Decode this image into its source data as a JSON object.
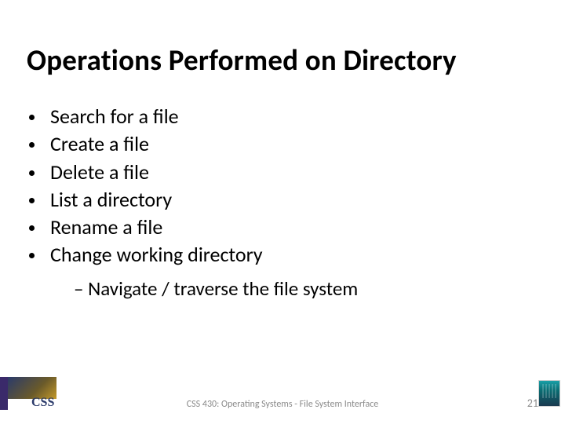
{
  "title": "Operations Performed on Directory",
  "bullets": [
    "Search for a file",
    "Create a file",
    "Delete a file",
    "List a directory",
    "Rename a file",
    "Change working directory"
  ],
  "sub_bullets": [
    "Navigate / traverse the file system"
  ],
  "footer": {
    "text": "CSS 430: Operating Systems - File System Interface",
    "page": "21",
    "logo_label": "CSS"
  }
}
